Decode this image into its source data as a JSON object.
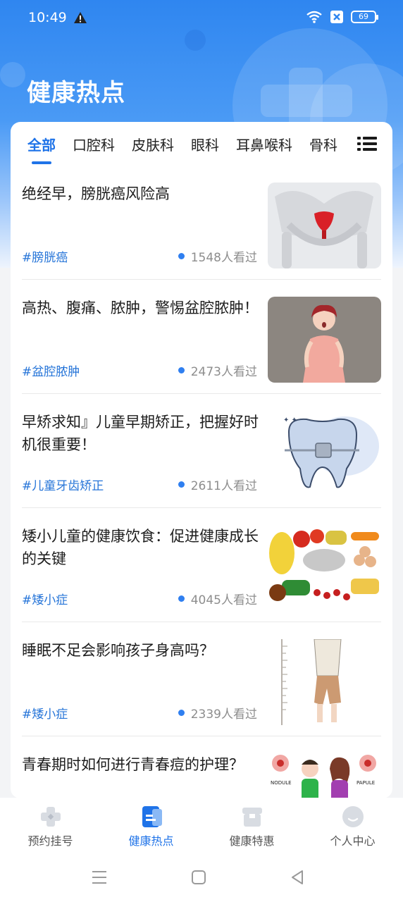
{
  "status_bar": {
    "time": "10:49",
    "battery": "69"
  },
  "page_title": "健康热点",
  "tabs": [
    {
      "label": "全部",
      "active": true
    },
    {
      "label": "口腔科"
    },
    {
      "label": "皮肤科"
    },
    {
      "label": "眼科"
    },
    {
      "label": "耳鼻喉科"
    },
    {
      "label": "骨科"
    }
  ],
  "articles": [
    {
      "title": "绝经早，膀胱癌风险高",
      "tag": "#膀胱癌",
      "views": "1548人看过",
      "image": "pelvis-illustration"
    },
    {
      "title": "高热、腹痛、脓肿，警惕盆腔脓肿！",
      "tag": "#盆腔脓肿",
      "views": "2473人看过",
      "image": "woman-illustration"
    },
    {
      "title": "早矫求知』儿童早期矫正，把握好时机很重要！",
      "tag": "#儿童牙齿矫正",
      "views": "2611人看过",
      "image": "tooth-braces-illustration"
    },
    {
      "title": "矮小儿童的健康饮食：促进健康成长的关键",
      "tag": "#矮小症",
      "views": "4045人看过",
      "image": "food-illustration"
    },
    {
      "title": "睡眠不足会影响孩子身高吗？",
      "tag": "#矮小症",
      "views": "2339人看过",
      "image": "child-height-illustration"
    },
    {
      "title": "青春期时如何进行青春痘的护理？",
      "tag": "",
      "views": "",
      "image": "acne-illustration",
      "image_labels": [
        "NODULE",
        "PAPULE"
      ]
    }
  ],
  "bottom_nav": [
    {
      "label": "预约挂号",
      "icon": "hospital-icon"
    },
    {
      "label": "健康热点",
      "icon": "news-icon",
      "active": true
    },
    {
      "label": "健康特惠",
      "icon": "gift-icon"
    },
    {
      "label": "个人中心",
      "icon": "user-icon"
    }
  ],
  "colors": {
    "primary": "#1f73e8",
    "header": "#2f86f0"
  }
}
